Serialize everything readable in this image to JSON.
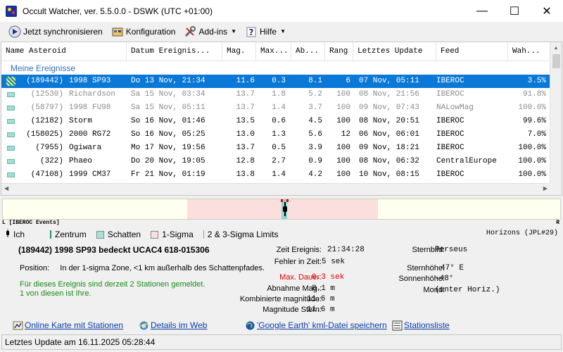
{
  "window": {
    "title": "Occult Watcher, ver. 5.5.0.0 - DSWK (UTC +01:00)",
    "minimize": "—",
    "maximize": "☐",
    "close": "✕"
  },
  "toolbar": {
    "sync": "Jetzt synchronisieren",
    "config": "Konfiguration",
    "addins": "Add-ins",
    "help": "Hilfe"
  },
  "table": {
    "columns": [
      "Name Asteroid",
      "Datum Ereignis...",
      "Mag.",
      "Max...",
      "Ab...",
      "Rang",
      "Letztes Update",
      "Feed",
      "Wah..."
    ],
    "group": "Meine Ereignisse",
    "rows": [
      {
        "name": "(189442) 1998 SP93",
        "date": "Do 13 Nov, 21:34",
        "mag": "11.6",
        "max": "0.3",
        "ab": "8.1",
        "rank": "6",
        "update": "07 Nov, 05:11",
        "feed": "IBEROC",
        "prob": "3.5%",
        "state": "selected"
      },
      {
        "name": "(12530) Richardson",
        "date": "Sa 15 Nov, 03:34",
        "mag": "13.7",
        "max": "1.8",
        "ab": "5.2",
        "rank": "100",
        "update": "08 Nov, 21:56",
        "feed": "IBEROC",
        "prob": "91.8%",
        "state": "dim"
      },
      {
        "name": "(58797) 1998 FU98",
        "date": "Sa 15 Nov, 05:11",
        "mag": "13.7",
        "max": "1.4",
        "ab": "3.7",
        "rank": "100",
        "update": "09 Nov, 07:43",
        "feed": "NALowMag",
        "prob": "100.0%",
        "state": "dim"
      },
      {
        "name": "(12182) Storm",
        "date": "So 16 Nov, 01:46",
        "mag": "13.5",
        "max": "0.6",
        "ab": "4.5",
        "rank": "100",
        "update": "08 Nov, 20:51",
        "feed": "IBEROC",
        "prob": "99.6%",
        "state": "normal"
      },
      {
        "name": "(158025) 2000 RG72",
        "date": "So 16 Nov, 05:25",
        "mag": "13.0",
        "max": "1.3",
        "ab": "5.6",
        "rank": "12",
        "update": "06 Nov, 06:01",
        "feed": "IBEROC",
        "prob": "7.0%",
        "state": "normal"
      },
      {
        "name": "(7955) Ogiwara",
        "date": "Mo 17 Nov, 19:56",
        "mag": "13.7",
        "max": "0.5",
        "ab": "3.9",
        "rank": "100",
        "update": "09 Nov, 18:21",
        "feed": "IBEROC",
        "prob": "100.0%",
        "state": "normal"
      },
      {
        "name": "(322) Phaeo",
        "date": "Do 20 Nov, 19:05",
        "mag": "12.8",
        "max": "2.7",
        "ab": "0.9",
        "rank": "100",
        "update": "08 Nov, 06:32",
        "feed": "CentralEurope",
        "prob": "100.0%",
        "state": "normal"
      },
      {
        "name": "(47108) 1999 CM37",
        "date": "Fr 21 Nov, 01:19",
        "mag": "13.8",
        "max": "1.4",
        "ab": "4.2",
        "rank": "100",
        "update": "10 Nov, 08:15",
        "feed": "IBEROC",
        "prob": "100.0%",
        "state": "normal"
      }
    ]
  },
  "timeline": {
    "left_label": "L [IBEROC Events]",
    "right_label": "R"
  },
  "legend": {
    "ich": "Ich",
    "zentrum": "Zentrum",
    "schatten": "Schatten",
    "sigma": "1-Sigma",
    "limits": "2 & 3-Sigma Limits",
    "horizons": "Horizons (JPL#29)"
  },
  "details": {
    "title": "(189442) 1998 SP93 bedeckt UCAC4 618-015306",
    "position_label": "Position:",
    "position_text": "In der 1-sigma Zone, <1 km außerhalb des Schattenpfades.",
    "stations_line1": "Für dieses Ereignis sind derzeit 2 Stationen gemeldet.",
    "stations_line2": "1 von diesen ist Ihre.",
    "zeit_label": "Zeit Ereignis:",
    "zeit_value": "21:34:28",
    "fehler_label": "Fehler in Zeit:",
    "fehler_value": "5 sek",
    "dauer_label": "Max. Dauer:",
    "dauer_value": "0.3 sek",
    "abnahme_label": "Abnahme Mag.:",
    "abnahme_value": "8.1 m",
    "komb_label": "Kombinierte magnitude:",
    "komb_value": "11.6 m",
    "magstern_label": "Magnitude Stern:",
    "magstern_value": "11.6 m",
    "sternbild_label": "Sternbild:",
    "sternbild_value": "Perseus",
    "sternhoehe_label": "Sternhöhe:",
    "sternhoehe_value": "47° E",
    "sonnenhoehe_label": "Sonnenhöhe:",
    "sonnenhoehe_value": "-48°",
    "mond_label": "Mond:",
    "mond_value": "(unter Horiz.)"
  },
  "links": {
    "online_map": "Online Karte mit Stationen",
    "details_web": "Details im Web",
    "google_earth": "'Google Earth' kml-Datei speichern",
    "stations": "Stationsliste"
  },
  "status": {
    "text": "Letztes Update am 16.11.2025 05:28:44"
  }
}
